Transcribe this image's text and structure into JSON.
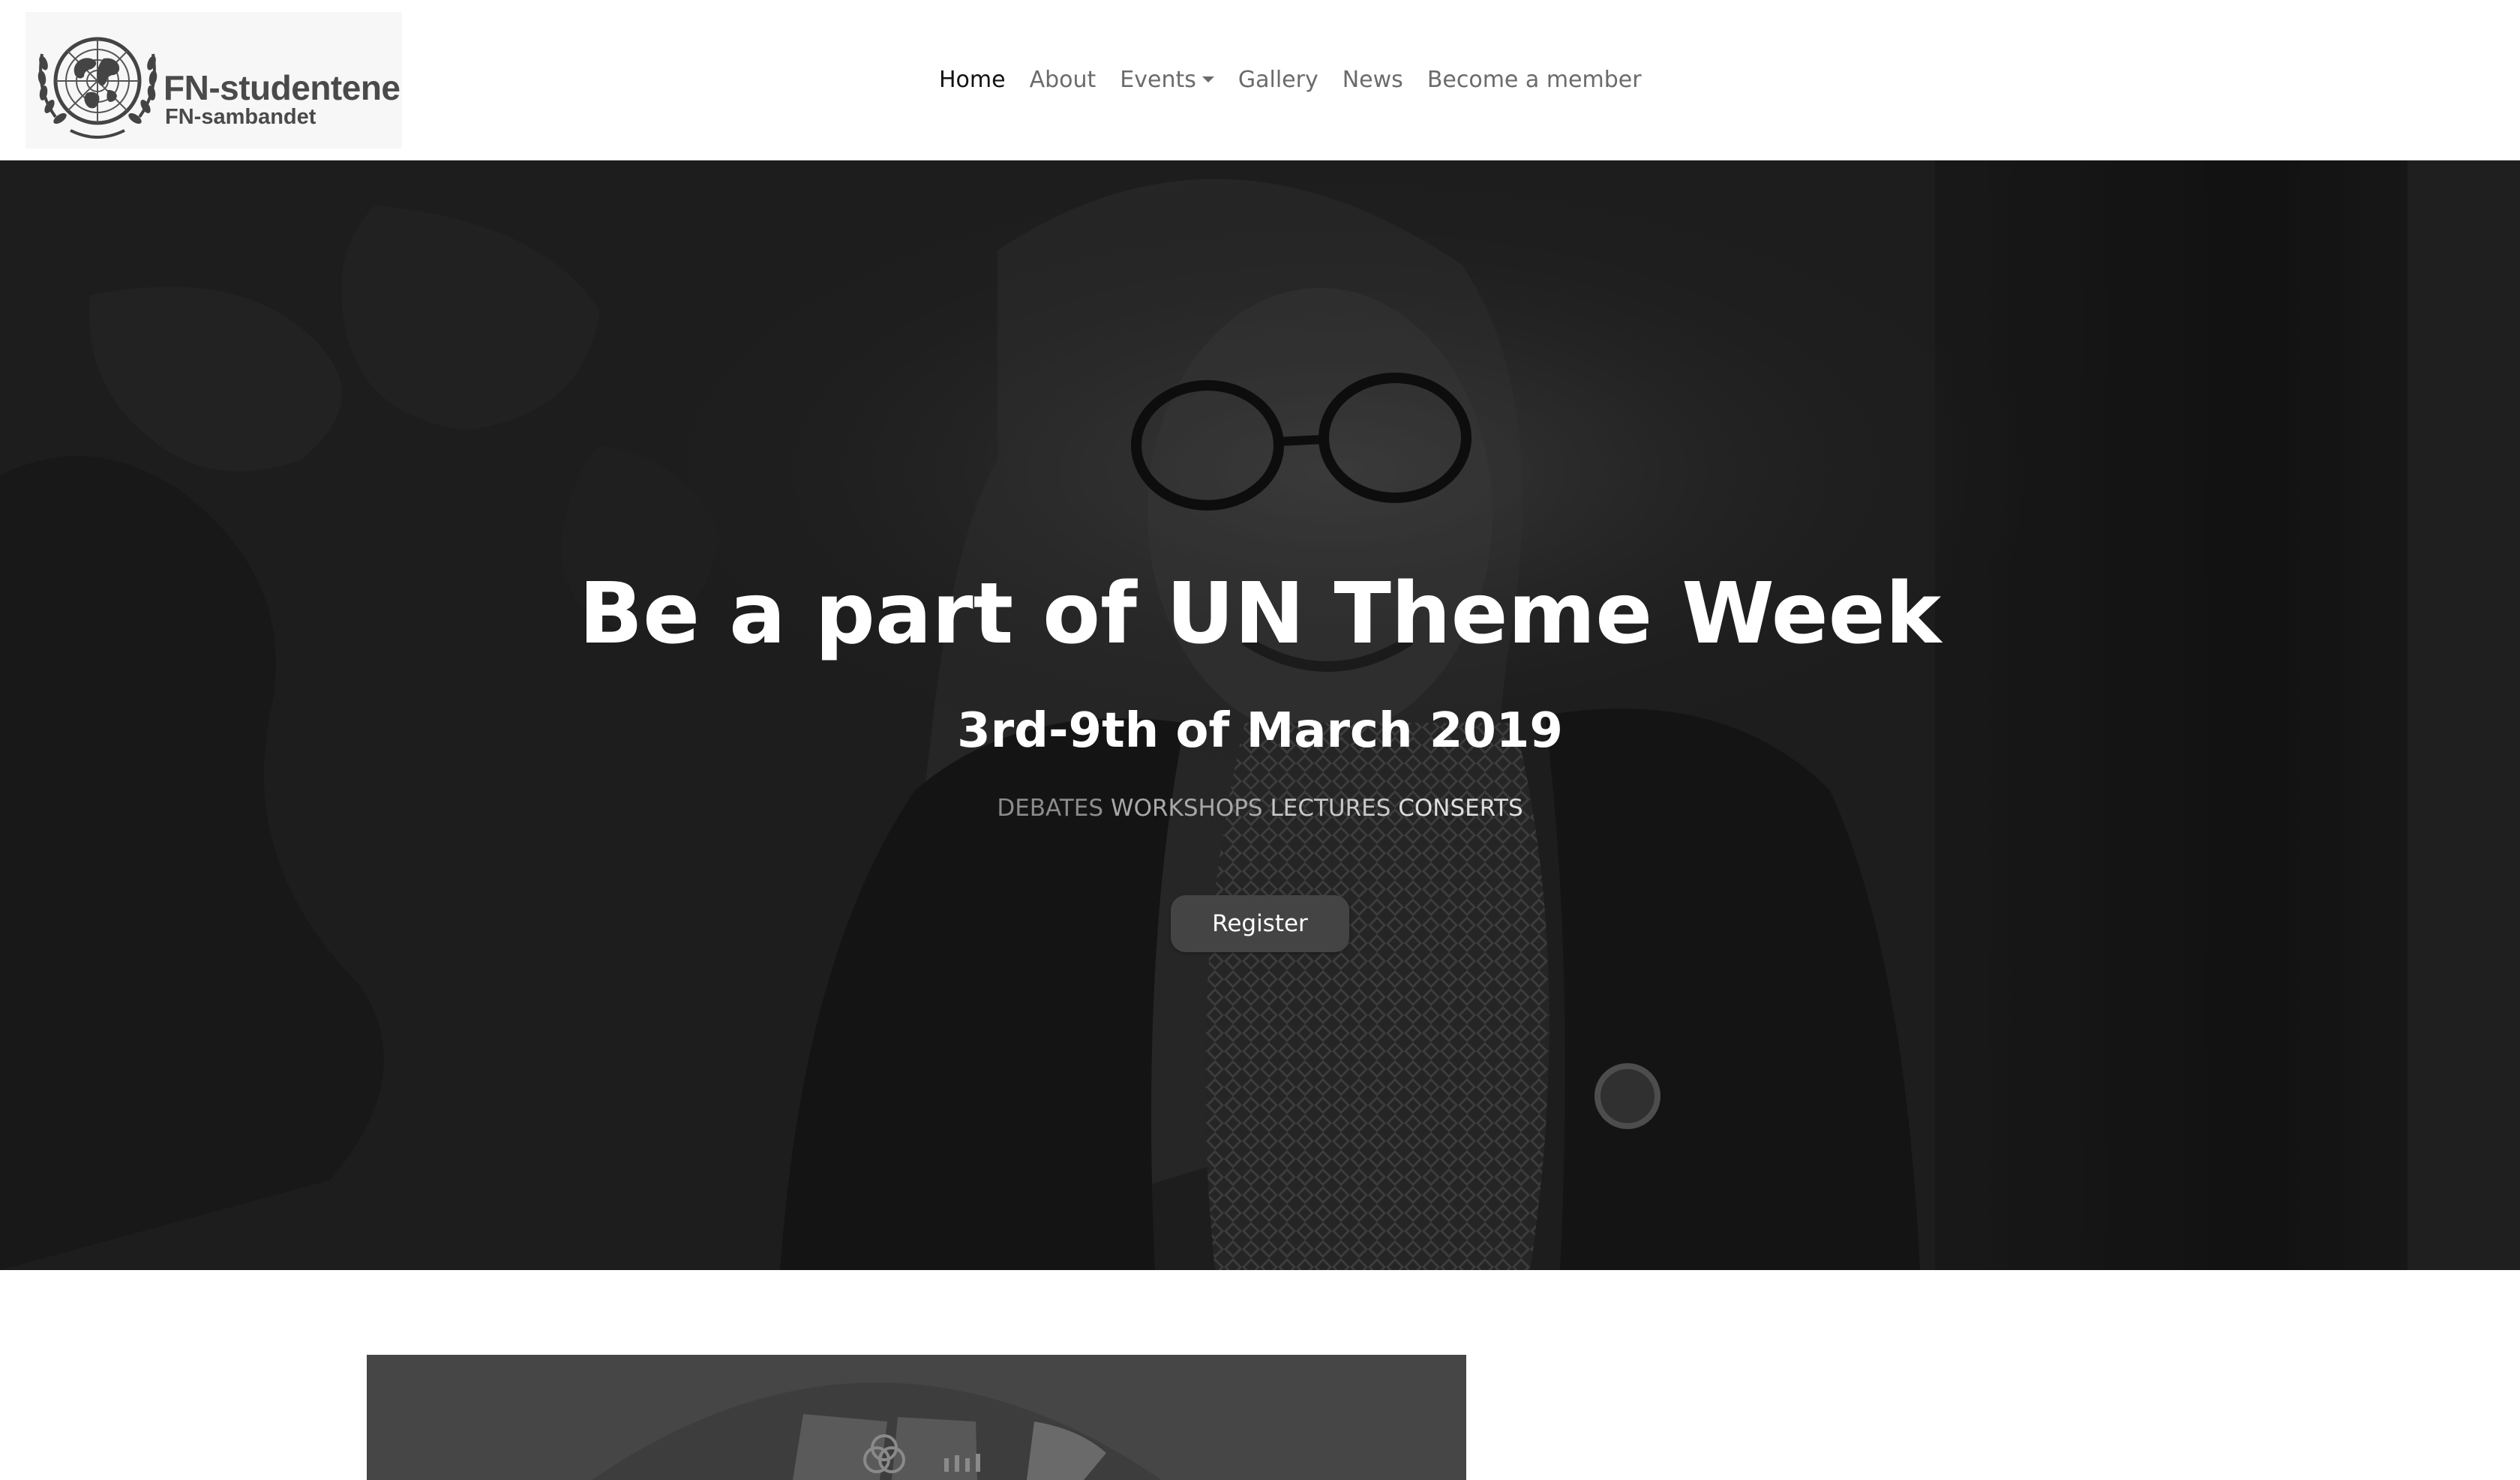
{
  "brand": {
    "title": "FN-studentene",
    "subtitle": "FN-sambandet",
    "logo_icon": "un-emblem-icon"
  },
  "nav": {
    "items": [
      {
        "label": "Home",
        "active": true
      },
      {
        "label": "About",
        "active": false
      },
      {
        "label": "Events",
        "active": false,
        "dropdown": true
      },
      {
        "label": "Gallery",
        "active": false
      },
      {
        "label": "News",
        "active": false
      },
      {
        "label": "Become a member",
        "active": false
      }
    ]
  },
  "hero": {
    "title": "Be a part of UN Theme Week",
    "date": "3rd-9th of March 2019",
    "tags": [
      "DEBATES",
      "WORKSHOPS",
      "LECTURES",
      "CONSERTS"
    ],
    "cta_label": "Register"
  },
  "colors": {
    "hero_overlay": "#2a2a2a",
    "text_on_dark": "#ffffff",
    "button_bg": "#444444",
    "nav_text": "#6b6b6b",
    "nav_active": "#111111"
  }
}
